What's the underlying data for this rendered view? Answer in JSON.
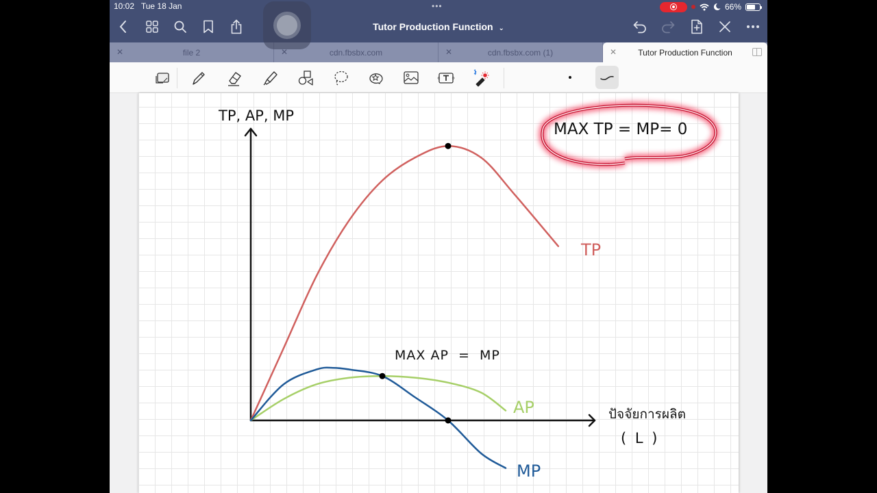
{
  "status_bar": {
    "time": "10:02",
    "date": "Tue 18 Jan",
    "battery_percent": "66%",
    "battery_level": 0.66,
    "recording": true
  },
  "nav": {
    "document_title": "Tutor Production Function",
    "left_icons": [
      "back-chevron-icon",
      "grid-icon",
      "search-icon",
      "bookmark-icon",
      "share-icon"
    ],
    "right_icons": [
      "undo-icon",
      "redo-icon",
      "add-page-icon",
      "close-x-icon",
      "more-icon"
    ]
  },
  "tabs": [
    {
      "label": "file 2",
      "active": false
    },
    {
      "label": "cdn.fbsbx.com",
      "active": false
    },
    {
      "label": "cdn.fbsbx.com (1)",
      "active": false
    },
    {
      "label": "Tutor Production Function",
      "active": true
    }
  ],
  "toolbar": {
    "tools": [
      "page-tool-icon",
      "pen-icon",
      "eraser-icon",
      "highlighter-icon",
      "shapes-icon",
      "lasso-icon",
      "sticker-icon",
      "image-icon",
      "text-icon",
      "laser-pointer-icon"
    ],
    "selected_stroke": "curve-stroke"
  },
  "colors": {
    "topbar": "#434f74",
    "tab_inactive": "#8890ad",
    "tp_curve": "#d0605e",
    "ap_curve": "#a6cf67",
    "mp_curve": "#1f5a98",
    "highlight_glow": "#e8163a"
  },
  "note": {
    "axis_y_label": "TP, AP, MP",
    "axis_x_label_line1": "ปัจจัยการผลิต",
    "axis_x_label_line2": "( L )",
    "tp_label": "TP",
    "ap_label": "AP",
    "mp_label": "MP",
    "annotation_max_ap": "MAX AP  =  MP",
    "annotation_max_tp": "MAX TP = MP= 0"
  },
  "chart_data": {
    "type": "line",
    "title": "",
    "xlabel": "ปัจจัยการผลิต ( L )",
    "ylabel": "TP, AP, MP",
    "grid": true,
    "x_range": [
      0,
      21
    ],
    "y_range": [
      -3.2,
      17.5
    ],
    "series": [
      {
        "name": "TP",
        "color": "#d0605e",
        "x": [
          0,
          2,
          4,
          6,
          8,
          10,
          12,
          14,
          16,
          18.7
        ],
        "y": [
          0,
          4.4,
          8.8,
          12.2,
          14.6,
          16.0,
          16.7,
          16.0,
          13.8,
          10.6
        ]
      },
      {
        "name": "AP",
        "color": "#a6cf67",
        "x": [
          0,
          2,
          4,
          6,
          8,
          10,
          12,
          14,
          15.5
        ],
        "y": [
          0,
          1.3,
          2.2,
          2.6,
          2.7,
          2.6,
          2.3,
          1.7,
          0.6
        ]
      },
      {
        "name": "MP",
        "color": "#1f5a98",
        "x": [
          0,
          2,
          4,
          5,
          6,
          8,
          10,
          12,
          14,
          15.5
        ],
        "y": [
          0,
          2.2,
          3.1,
          3.2,
          3.1,
          2.7,
          1.4,
          0,
          -2.0,
          -2.9
        ]
      }
    ],
    "points": [
      {
        "label": "max TP",
        "x": 12,
        "y": 16.7
      },
      {
        "label": "max AP = MP",
        "x": 8,
        "y": 2.7
      },
      {
        "label": "MP = 0",
        "x": 12,
        "y": 0
      }
    ],
    "annotations": [
      "MAX AP = MP",
      "MAX TP = MP= 0"
    ],
    "legend": "inline-labels-right"
  }
}
